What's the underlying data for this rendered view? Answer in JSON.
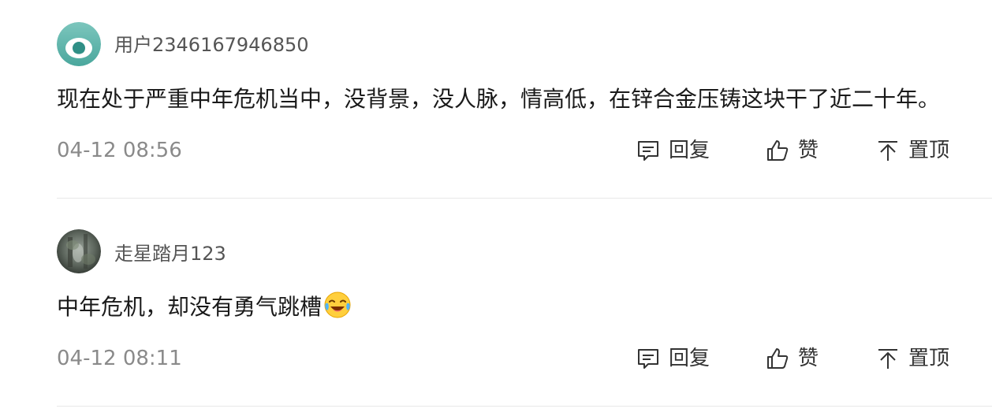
{
  "comments": [
    {
      "username": "用户2346167946850",
      "content": "现在处于严重中年危机当中，没背景，没人脉，情高低，在锌合金压铸这块干了近二十年。",
      "timestamp": "04-12 08:56",
      "avatar_icon": "default-user-avatar-icon",
      "actions": {
        "reply_label": "回复",
        "like_label": "赞",
        "pin_label": "置顶"
      }
    },
    {
      "username": "走星踏月123",
      "content": "中年危机，却没有勇气跳槽",
      "content_emoji": "crying-laughing-emoji-icon",
      "timestamp": "04-12 08:11",
      "avatar_icon": "photo-avatar-icon",
      "actions": {
        "reply_label": "回复",
        "like_label": "赞",
        "pin_label": "置顶"
      }
    }
  ],
  "colors": {
    "background": "#ffffff",
    "username": "#555555",
    "content": "#1a1a1a",
    "timestamp": "#8a8a8a",
    "action": "#333333",
    "divider": "#e8e8e8",
    "avatar_teal": "#5fb7ae"
  }
}
